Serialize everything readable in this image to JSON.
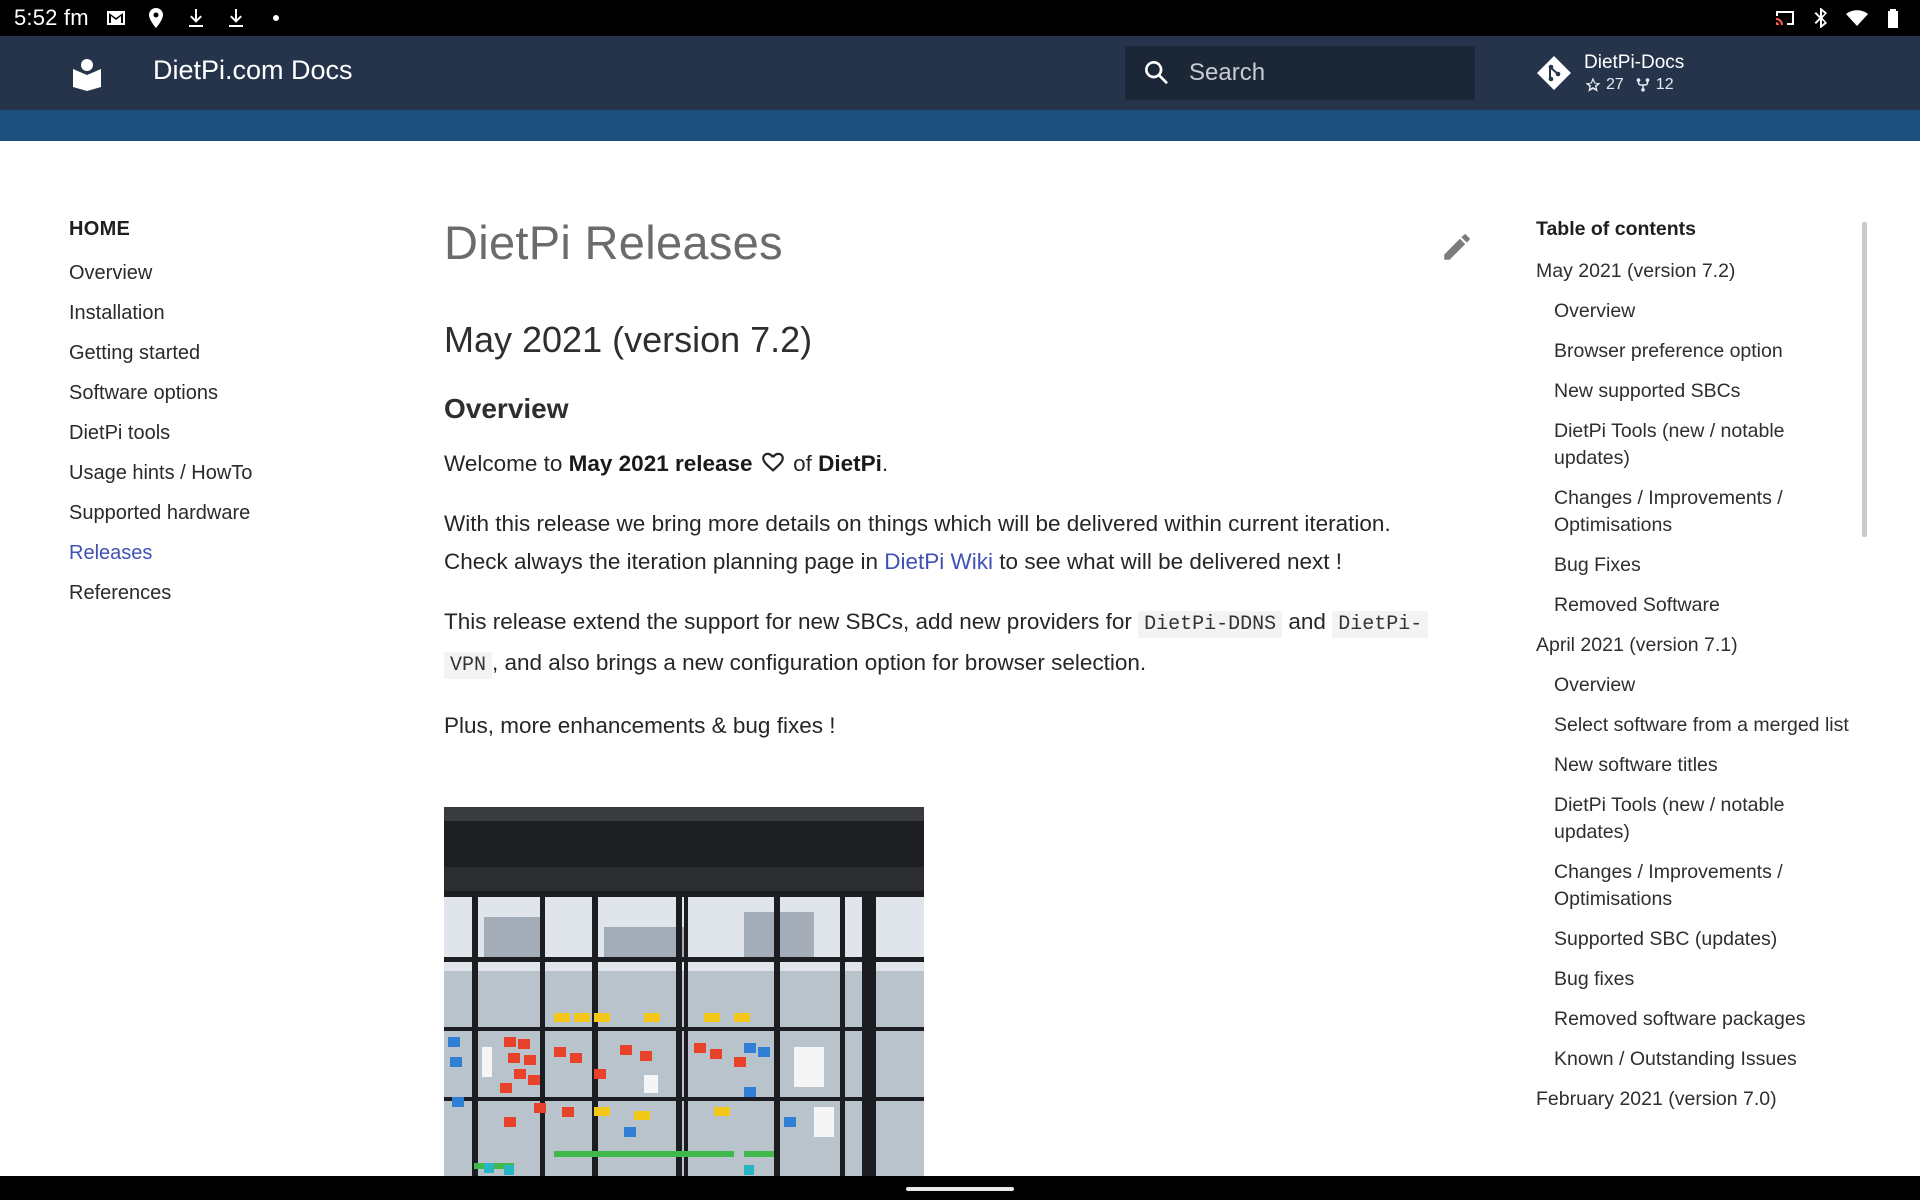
{
  "status_bar": {
    "time": "5:52 fm",
    "left_icons": [
      "gmail-icon",
      "location-icon",
      "download-icon",
      "download-icon",
      "dot-icon"
    ],
    "right_icons": [
      "cast-icon",
      "bluetooth-icon",
      "wifi-icon",
      "battery-icon"
    ]
  },
  "header": {
    "site_title": "DietPi.com Docs",
    "search_placeholder": "Search",
    "repo": {
      "name": "DietPi-Docs",
      "stars": "27",
      "forks": "12"
    },
    "colors": {
      "header_bg": "#25344a",
      "tabs_bg": "#1c4f7e"
    }
  },
  "left_nav": {
    "home": "HOME",
    "items": [
      {
        "label": "Overview",
        "active": false
      },
      {
        "label": "Installation",
        "active": false
      },
      {
        "label": "Getting started",
        "active": false
      },
      {
        "label": "Software options",
        "active": false
      },
      {
        "label": "DietPi tools",
        "active": false
      },
      {
        "label": "Usage hints / HowTo",
        "active": false
      },
      {
        "label": "Supported hardware",
        "active": false
      },
      {
        "label": "Releases",
        "active": true
      },
      {
        "label": "References",
        "active": false
      }
    ],
    "active_color": "#3f51b5"
  },
  "content": {
    "page_title": "DietPi Releases",
    "h2": "May 2021 (version 7.2)",
    "h3": "Overview",
    "p1": {
      "prefix": "Welcome to ",
      "bold1": "May 2021 release",
      "middle": " of ",
      "bold2": "DietPi",
      "suffix": "."
    },
    "p2": {
      "line1": "With this release we bring more details on things which will be delivered within current iteration.",
      "pre_link": "Check always the iteration planning page in ",
      "link": "DietPi Wiki",
      "post_link": " to see what will be delivered next !"
    },
    "p3": {
      "prefix": "This release extend the support for new SBCs, add new providers for ",
      "code1": "DietPi-DDNS",
      "middle": " and ",
      "code2a": "DietPi-",
      "code2b": "VPN",
      "suffix": ", and also brings a new configuration option for browser selection."
    },
    "p4": "Plus, more enhancements & bug fixes !"
  },
  "toc": {
    "title": "Table of contents",
    "items": [
      {
        "label": "May 2021 (version 7.2)",
        "level": 1
      },
      {
        "label": "Overview",
        "level": 2
      },
      {
        "label": "Browser preference option",
        "level": 2
      },
      {
        "label": "New supported SBCs",
        "level": 2
      },
      {
        "label": "DietPi Tools (new / notable updates)",
        "level": 2
      },
      {
        "label": "Changes / Improvements / Optimisations",
        "level": 2
      },
      {
        "label": "Bug Fixes",
        "level": 2
      },
      {
        "label": "Removed Software",
        "level": 2
      },
      {
        "label": "April 2021 (version 7.1)",
        "level": 1
      },
      {
        "label": "Overview",
        "level": 2
      },
      {
        "label": "Select software from a merged list",
        "level": 2
      },
      {
        "label": "New software titles",
        "level": 2
      },
      {
        "label": "DietPi Tools (new / notable updates)",
        "level": 2
      },
      {
        "label": "Changes / Improvements / Optimisations",
        "level": 2
      },
      {
        "label": "Supported SBC (updates)",
        "level": 2
      },
      {
        "label": "Bug fixes",
        "level": 2
      },
      {
        "label": "Removed software packages",
        "level": 2
      },
      {
        "label": "Known / Outstanding Issues",
        "level": 2
      },
      {
        "label": "February 2021 (version 7.0)",
        "level": 1
      }
    ]
  }
}
